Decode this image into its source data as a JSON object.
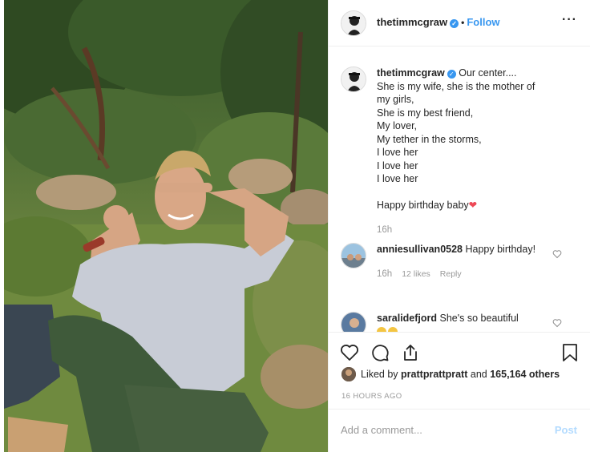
{
  "post": {
    "username": "thetimmcgraw",
    "follow_label": "Follow",
    "separator": "•",
    "more_label": "···"
  },
  "caption": {
    "username": "thetimmcgraw",
    "lines": [
      "Our center....",
      "She is my wife, she is the mother of",
      "my girls,",
      "She is my best friend,",
      "My lover,",
      "My tether in the storms,",
      "I love her",
      "I love her",
      "I love her",
      "",
      "Happy birthday baby"
    ],
    "heart_emoji": "❤",
    "age": "16h"
  },
  "comments": [
    {
      "username": "anniesullivan0528",
      "text": "Happy birthday!",
      "age": "16h",
      "likes": "12 likes",
      "reply": "Reply"
    },
    {
      "username": "saralidefjord",
      "text": "She's so beautiful"
    }
  ],
  "likes": {
    "prefix": "Liked by",
    "user": "prattprattpratt",
    "joiner": "and",
    "count": "165,164 others"
  },
  "timestamp": "16 HOURS AGO",
  "add_comment": {
    "placeholder": "Add a comment...",
    "post_label": "Post"
  },
  "icons": {
    "like": "heart-icon",
    "comment": "comment-icon",
    "share": "share-icon",
    "save": "bookmark-icon",
    "verified": "verified-badge-icon"
  },
  "colors": {
    "accent": "#3897f0",
    "post_disabled": "#b3dbff",
    "heart": "#ed4956"
  }
}
